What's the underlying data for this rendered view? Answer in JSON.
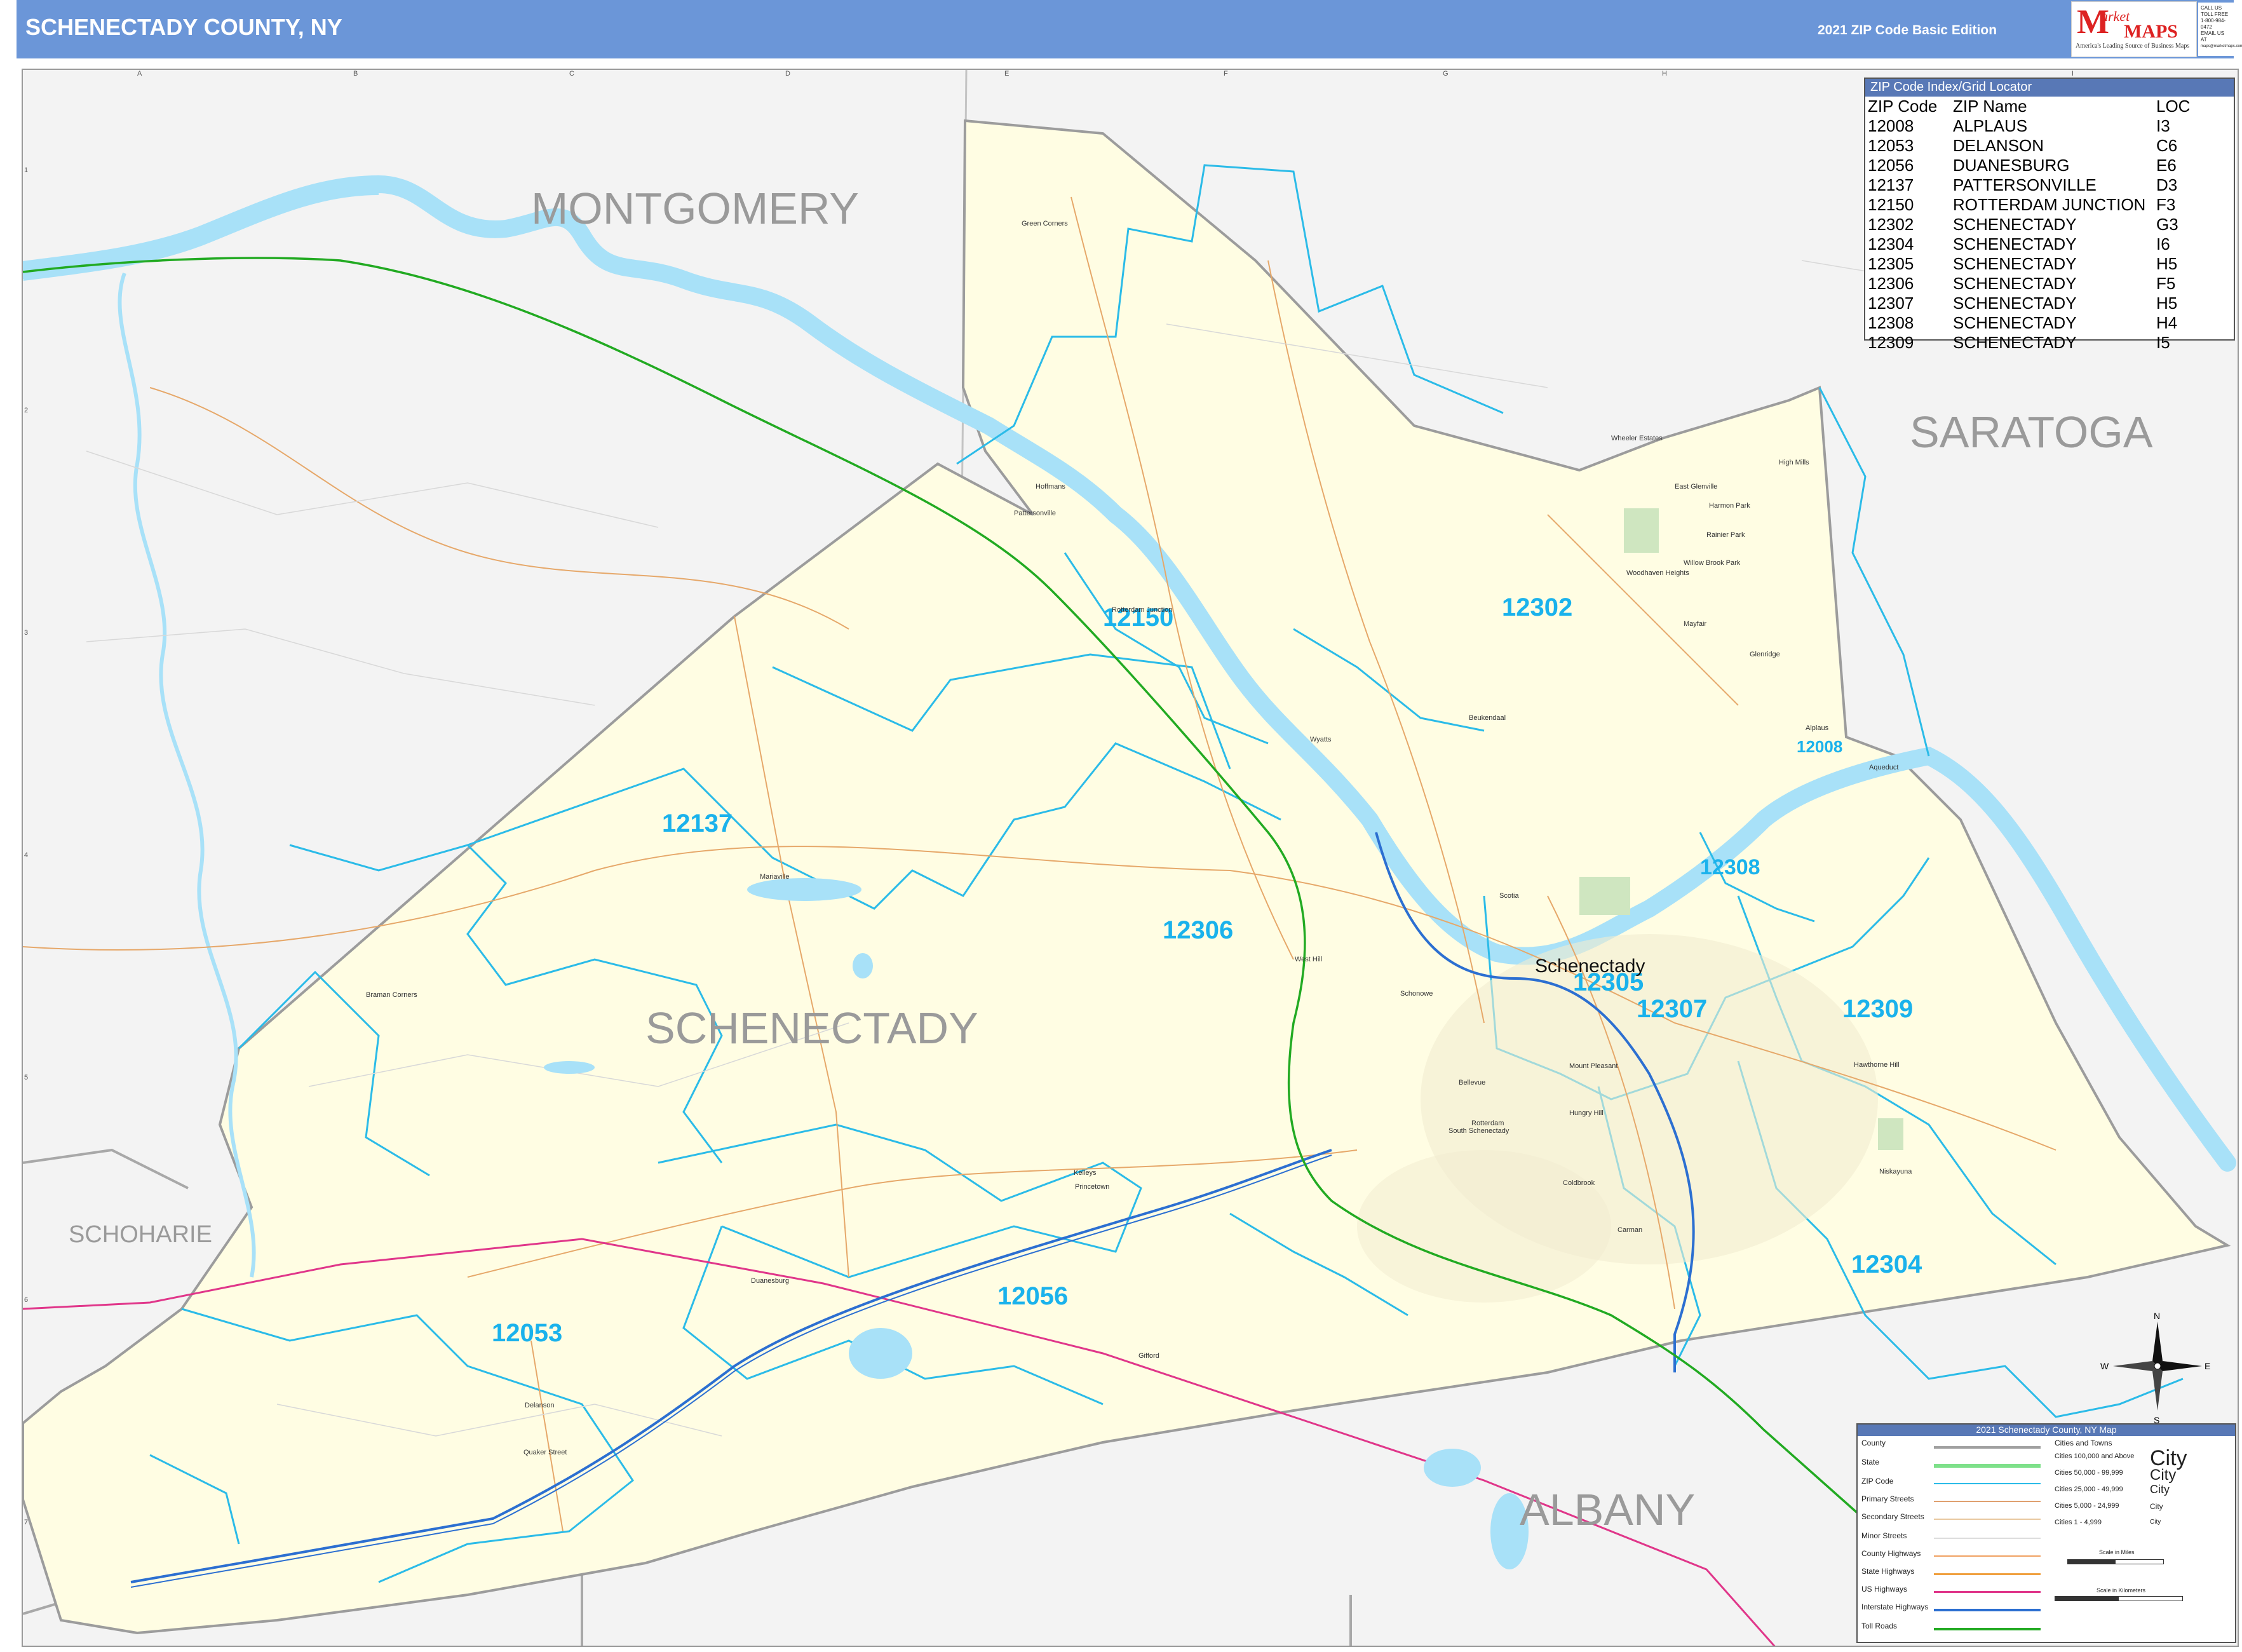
{
  "header": {
    "title": "SCHENECTADY COUNTY, NY",
    "edition": "2021 ZIP Code Basic Edition",
    "logo_m": "M",
    "logo_market": "arket",
    "logo_maps": "MAPS",
    "logo_tagline": "America's Leading Source of Business Maps",
    "contact": [
      "CALL US TOLL FREE",
      "1-800-984-0472",
      "EMAIL US AT",
      "maps@marketmaps.com"
    ]
  },
  "grid": {
    "columns": [
      "A",
      "B",
      "C",
      "D",
      "E",
      "F",
      "G",
      "H",
      "I"
    ],
    "rows": [
      "1",
      "2",
      "3",
      "4",
      "5",
      "6",
      "7"
    ]
  },
  "counties": {
    "montgomery": "MONTGOMERY",
    "saratoga": "SARATOGA",
    "schenectady": "SCHENECTADY",
    "schoharie": "SCHOHARIE",
    "albany": "ALBANY"
  },
  "zip_labels": [
    "12150",
    "12302",
    "12008",
    "12137",
    "12308",
    "12306",
    "12305",
    "12307",
    "12309",
    "12056",
    "12304",
    "12053"
  ],
  "city_label": "Schenectady",
  "places": [
    "Green Corners",
    "Hoffmans",
    "Pattersonville",
    "Rotterdam Junction",
    "Wheeler Estates",
    "High Mills",
    "East Glenville",
    "Harmon Park",
    "Rainier Park",
    "Willow Brook Park",
    "Woodhaven Heights",
    "Mayfair",
    "Glenridge",
    "Beukendaal",
    "Wyatts",
    "Aqueduct",
    "Alplaus",
    "Scotia",
    "Mariaville",
    "West Hill",
    "Braman Corners",
    "Schonowe",
    "Mount Pleasant",
    "Bellevue",
    "Hungry Hill",
    "Rotterdam",
    "South Schenectady",
    "Hawthorne Hill",
    "Niskayuna",
    "Coldbrook",
    "Carman",
    "Kelleys",
    "Princetown",
    "Duanesburg",
    "Gifford",
    "Delanson",
    "Quaker Street"
  ],
  "zip_index": {
    "title": "ZIP Code Index/Grid Locator",
    "headers": [
      "ZIP Code",
      "ZIP Name",
      "LOC"
    ],
    "rows": [
      [
        "12008",
        "ALPLAUS",
        "I3"
      ],
      [
        "12053",
        "DELANSON",
        "C6"
      ],
      [
        "12056",
        "DUANESBURG",
        "E6"
      ],
      [
        "12137",
        "PATTERSONVILLE",
        "D3"
      ],
      [
        "12150",
        "ROTTERDAM JUNCTION",
        "F3"
      ],
      [
        "12302",
        "SCHENECTADY",
        "G3"
      ],
      [
        "12304",
        "SCHENECTADY",
        "I6"
      ],
      [
        "12305",
        "SCHENECTADY",
        "H5"
      ],
      [
        "12306",
        "SCHENECTADY",
        "F5"
      ],
      [
        "12307",
        "SCHENECTADY",
        "H5"
      ],
      [
        "12308",
        "SCHENECTADY",
        "H4"
      ],
      [
        "12309",
        "SCHENECTADY",
        "I5"
      ]
    ]
  },
  "compass": {
    "n": "N",
    "s": "S",
    "e": "E",
    "w": "W"
  },
  "legend": {
    "title": "2021 Schenectady County, NY Map",
    "items": [
      "County",
      "State",
      "ZIP Code",
      "Primary Streets",
      "Secondary Streets",
      "Minor Streets",
      "County Highways",
      "State Highways",
      "US Highways",
      "Interstate Highways",
      "Toll Roads"
    ],
    "cities_header": "Cities and Towns",
    "city_sizes": [
      "Cities 100,000 and Above",
      "Cities 50,000 - 99,999",
      "Cities 25,000 - 49,999",
      "Cities 5,000 - 24,999",
      "Cities 1 - 4,999"
    ],
    "city_samples": [
      "City",
      "City",
      "City",
      "City",
      "City"
    ],
    "scale_miles": "Scale in Miles",
    "scale_km": "Scale in Kilometers",
    "colors": {
      "county": "#a0a0a0",
      "state": "#7ee08a",
      "zip": "#2bbbe8",
      "primary": "#e0a070",
      "secondary": "#e8c8a0",
      "minor": "#dddddd",
      "county_hwy": "#f0a060",
      "state_hwy": "#f0a040",
      "us_hwy": "#e0368a",
      "interstate": "#2c6fd1",
      "toll": "#22aa22"
    }
  }
}
